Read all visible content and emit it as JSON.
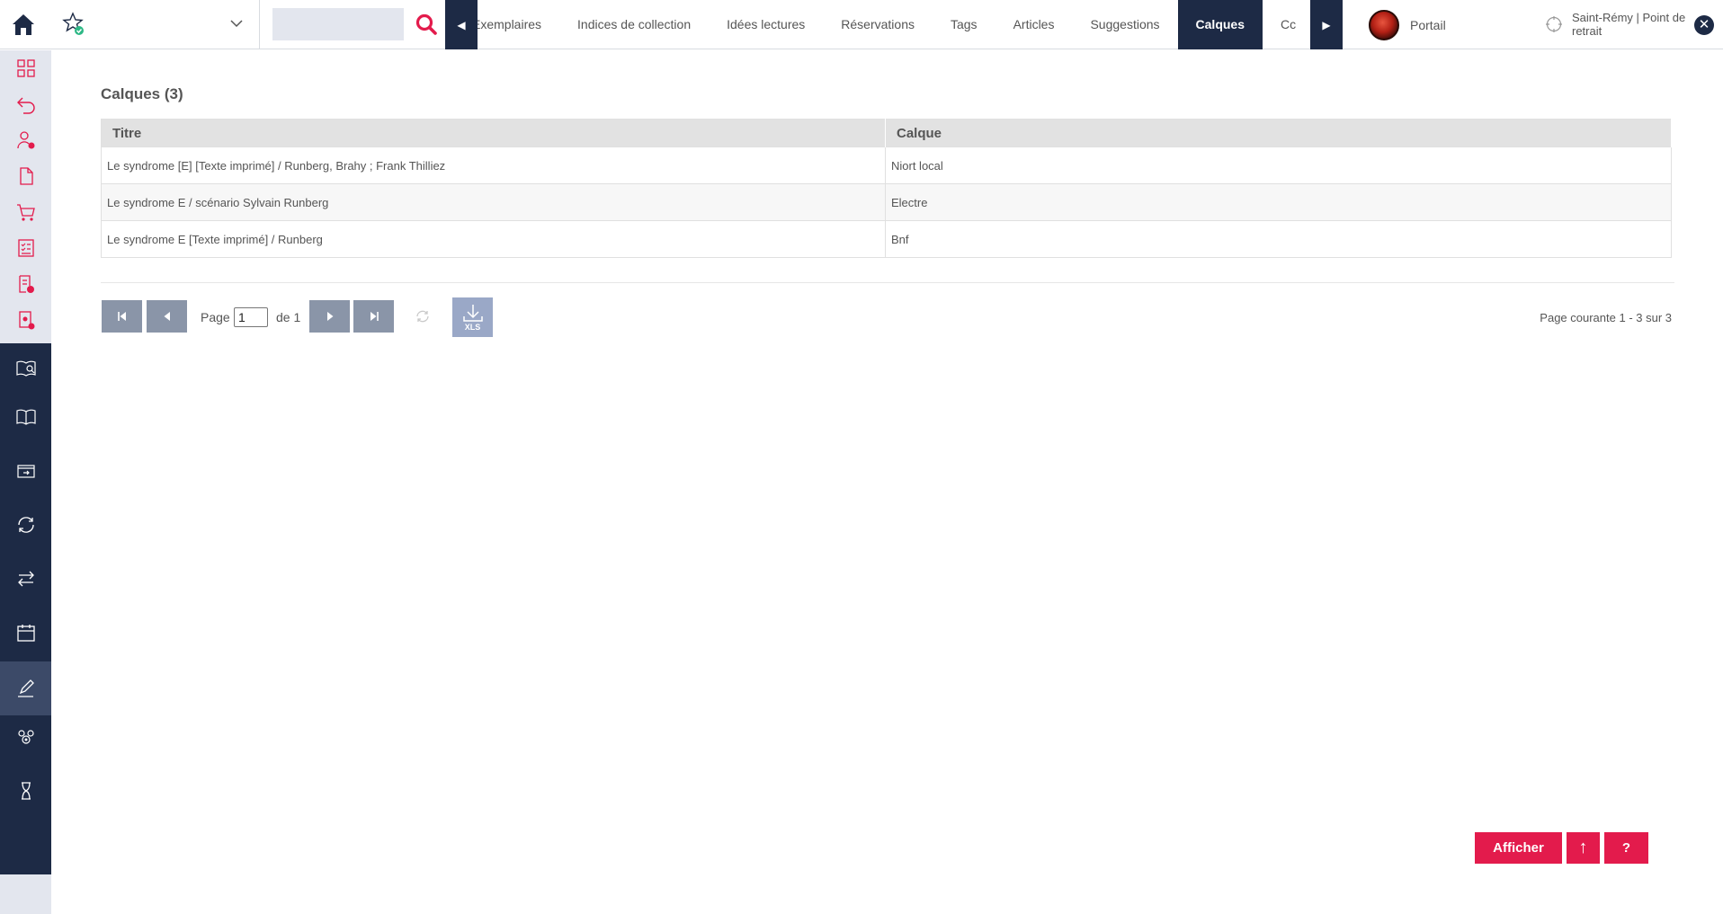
{
  "search": {
    "placeholder": "",
    "value": ""
  },
  "tabs": [
    {
      "label": "Exemplaires",
      "active": false
    },
    {
      "label": "Indices de collection",
      "active": false
    },
    {
      "label": "Idées lectures",
      "active": false
    },
    {
      "label": "Réservations",
      "active": false
    },
    {
      "label": "Tags",
      "active": false
    },
    {
      "label": "Articles",
      "active": false
    },
    {
      "label": "Suggestions",
      "active": false
    },
    {
      "label": "Calques",
      "active": true
    },
    {
      "label": "Cc",
      "active": false
    }
  ],
  "tab_arrows": {
    "left": "◀",
    "right": "▶"
  },
  "portail": {
    "label": "Portail"
  },
  "location": {
    "text": "Saint-Rémy | Point de retrait"
  },
  "close": {
    "symbol": "✕"
  },
  "main": {
    "title": "Calques (3)",
    "columns": [
      "Titre",
      "Calque"
    ],
    "rows": [
      {
        "titre": "Le syndrome [E] [Texte imprimé] / Runberg, Brahy ; Frank Thilliez",
        "calque": "Niort local"
      },
      {
        "titre": "Le syndrome E / scénario Sylvain Runberg",
        "calque": "Electre"
      },
      {
        "titre": "Le syndrome E [Texte imprimé] / Runberg",
        "calque": "Bnf"
      }
    ]
  },
  "pager": {
    "page_label": "Page",
    "page_value": "1",
    "of_label": "de 1",
    "info": "Page courante 1 - 3 sur 3",
    "xls_label": "XLS"
  },
  "actions": {
    "afficher": "Afficher",
    "top": "↑",
    "help": "?"
  },
  "colors": {
    "navy": "#1d2a45",
    "accent_red": "#e31b4c",
    "sidebar_light": "#e3e6ee",
    "pager_button": "#8a95a8",
    "xls_button": "#9aa8c7"
  },
  "icons": {
    "sidebar_light": [
      "dashboard-icon",
      "undo-icon",
      "user-settings-icon",
      "document-icon",
      "cart-icon",
      "checklist-icon",
      "document-alert-icon",
      "file-alert-icon"
    ],
    "sidebar_dark": [
      "catalog-search-icon",
      "book-icon",
      "inbox-icon",
      "sync-icon",
      "transfer-icon",
      "calendar-icon",
      "edit-icon",
      "settings-group-icon",
      "hourglass-icon"
    ]
  }
}
